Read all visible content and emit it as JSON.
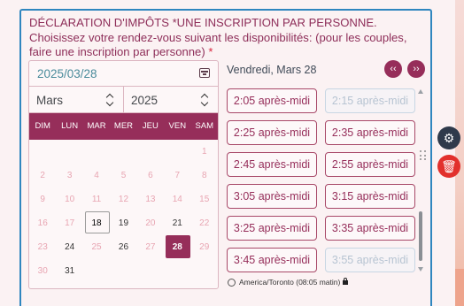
{
  "form": {
    "label_main": "DÉCLARATION D'IMPÔTS     *UNE INSCRIPTION PAR PERSONNE. Choisissez votre rendez-vous suivant les disponibilités: (pour les couples, faire une inscription par personne)",
    "required_mark": "*"
  },
  "calendar": {
    "date_value": "2025/03/28",
    "month": "Mars",
    "year": "2025",
    "weekdays": [
      "DIM",
      "LUN",
      "MAR",
      "MER",
      "JEU",
      "VEN",
      "SAM"
    ],
    "weeks": [
      [
        {
          "d": ""
        },
        {
          "d": ""
        },
        {
          "d": ""
        },
        {
          "d": ""
        },
        {
          "d": ""
        },
        {
          "d": ""
        },
        {
          "d": "1",
          "s": "muted"
        }
      ],
      [
        {
          "d": "2",
          "s": "muted"
        },
        {
          "d": "3",
          "s": "muted"
        },
        {
          "d": "4",
          "s": "muted"
        },
        {
          "d": "5",
          "s": "muted"
        },
        {
          "d": "6",
          "s": "muted"
        },
        {
          "d": "7",
          "s": "muted"
        },
        {
          "d": "8",
          "s": "muted"
        }
      ],
      [
        {
          "d": "9",
          "s": "muted"
        },
        {
          "d": "10",
          "s": "muted"
        },
        {
          "d": "11",
          "s": "muted"
        },
        {
          "d": "12",
          "s": "muted"
        },
        {
          "d": "13",
          "s": "muted"
        },
        {
          "d": "14",
          "s": "muted"
        },
        {
          "d": "15",
          "s": "muted"
        }
      ],
      [
        {
          "d": "16",
          "s": "muted"
        },
        {
          "d": "17",
          "s": "muted"
        },
        {
          "d": "18",
          "s": "today"
        },
        {
          "d": "19",
          "s": "active"
        },
        {
          "d": "20",
          "s": "muted"
        },
        {
          "d": "21",
          "s": "active"
        },
        {
          "d": "22",
          "s": "muted"
        }
      ],
      [
        {
          "d": "23",
          "s": "muted"
        },
        {
          "d": "24",
          "s": "active"
        },
        {
          "d": "25",
          "s": "muted"
        },
        {
          "d": "26",
          "s": "active"
        },
        {
          "d": "27",
          "s": "muted"
        },
        {
          "d": "28",
          "s": "selected"
        },
        {
          "d": "29",
          "s": "muted"
        }
      ],
      [
        {
          "d": "30",
          "s": "muted"
        },
        {
          "d": "31",
          "s": "active"
        },
        {
          "d": ""
        },
        {
          "d": ""
        },
        {
          "d": ""
        },
        {
          "d": ""
        },
        {
          "d": ""
        }
      ]
    ]
  },
  "slots": {
    "day_title": "Vendredi, Mars 28",
    "times": [
      {
        "label": "2:05 après-midi",
        "available": true
      },
      {
        "label": "2:15 après-midi",
        "available": false
      },
      {
        "label": "2:25 après-midi",
        "available": true
      },
      {
        "label": "2:35 après-midi",
        "available": true
      },
      {
        "label": "2:45 après-midi",
        "available": true
      },
      {
        "label": "2:55 après-midi",
        "available": true
      },
      {
        "label": "3:05 après-midi",
        "available": true
      },
      {
        "label": "3:15 après-midi",
        "available": true
      },
      {
        "label": "3:25 après-midi",
        "available": true
      },
      {
        "label": "3:35 après-midi",
        "available": true
      },
      {
        "label": "3:45 après-midi",
        "available": true
      },
      {
        "label": "3:55 après-midi",
        "available": false
      }
    ],
    "timezone": "America/Toronto (08:05 matin)"
  },
  "icons": {
    "calendar": "calendar-icon",
    "nav_prev": "prev-day-icon",
    "nav_next": "next-day-icon",
    "gear": "gear-icon",
    "trash": "trash-icon",
    "clock": "clock-icon",
    "lock": "lock-icon"
  },
  "colors": {
    "accent": "#962e5a",
    "border_focus": "#2f86bf",
    "delete": "#e2302c",
    "settings": "#2f3a4b"
  }
}
